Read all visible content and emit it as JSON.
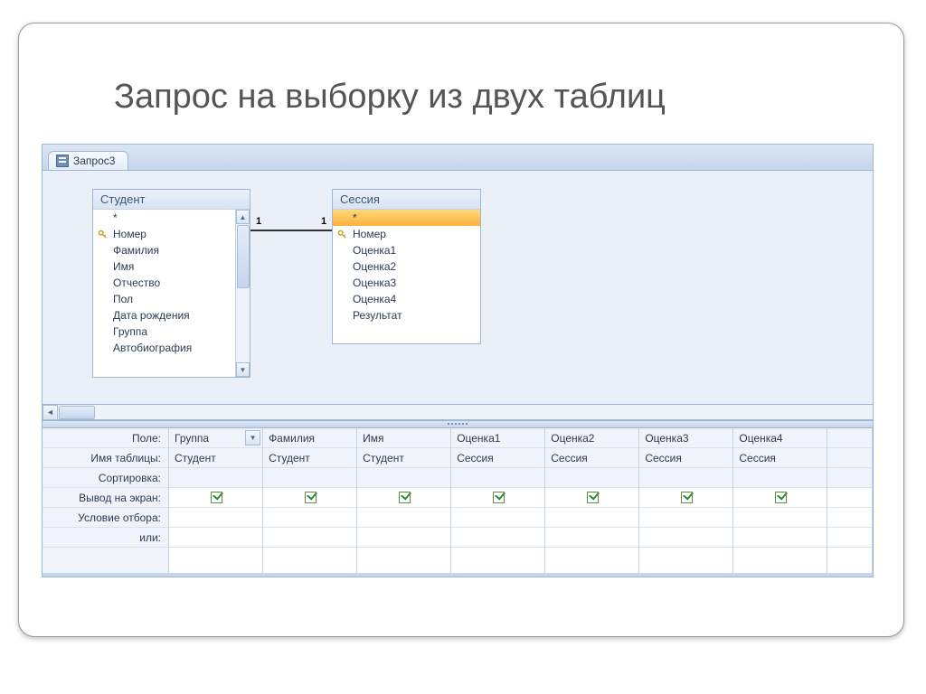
{
  "slide": {
    "title": "Запрос на выборку из двух таблиц"
  },
  "tab": {
    "label": "Запрос3"
  },
  "tables": {
    "student": {
      "title": "Студент",
      "fields": [
        "*",
        "Номер",
        "Фамилия",
        "Имя",
        "Отчество",
        "Пол",
        "Дата рождения",
        "Группа",
        "Автобиография"
      ],
      "key_index": 1,
      "selected_index": -1,
      "has_scroll": true
    },
    "session": {
      "title": "Сессия",
      "fields": [
        "*",
        "Номер",
        "Оценка1",
        "Оценка2",
        "Оценка3",
        "Оценка4",
        "Результат"
      ],
      "key_index": 1,
      "selected_index": 0,
      "has_scroll": false
    }
  },
  "join": {
    "left_label": "1",
    "right_label": "1"
  },
  "grid": {
    "labels": [
      "Поле:",
      "Имя таблицы:",
      "Сортировка:",
      "Вывод на экран:",
      "Условие отбора:",
      "или:"
    ],
    "columns": [
      {
        "field": "Группа",
        "table": "Студент",
        "sort": "",
        "show": true,
        "criteria": "",
        "or": "",
        "active": true
      },
      {
        "field": "Фамилия",
        "table": "Студент",
        "sort": "",
        "show": true,
        "criteria": "",
        "or": "",
        "active": false
      },
      {
        "field": "Имя",
        "table": "Студент",
        "sort": "",
        "show": true,
        "criteria": "",
        "or": "",
        "active": false
      },
      {
        "field": "Оценка1",
        "table": "Сессия",
        "sort": "",
        "show": true,
        "criteria": "",
        "or": "",
        "active": false
      },
      {
        "field": "Оценка2",
        "table": "Сессия",
        "sort": "",
        "show": true,
        "criteria": "",
        "or": "",
        "active": false
      },
      {
        "field": "Оценка3",
        "table": "Сессия",
        "sort": "",
        "show": true,
        "criteria": "",
        "or": "",
        "active": false
      },
      {
        "field": "Оценка4",
        "table": "Сессия",
        "sort": "",
        "show": true,
        "criteria": "",
        "or": "",
        "active": false
      }
    ]
  }
}
